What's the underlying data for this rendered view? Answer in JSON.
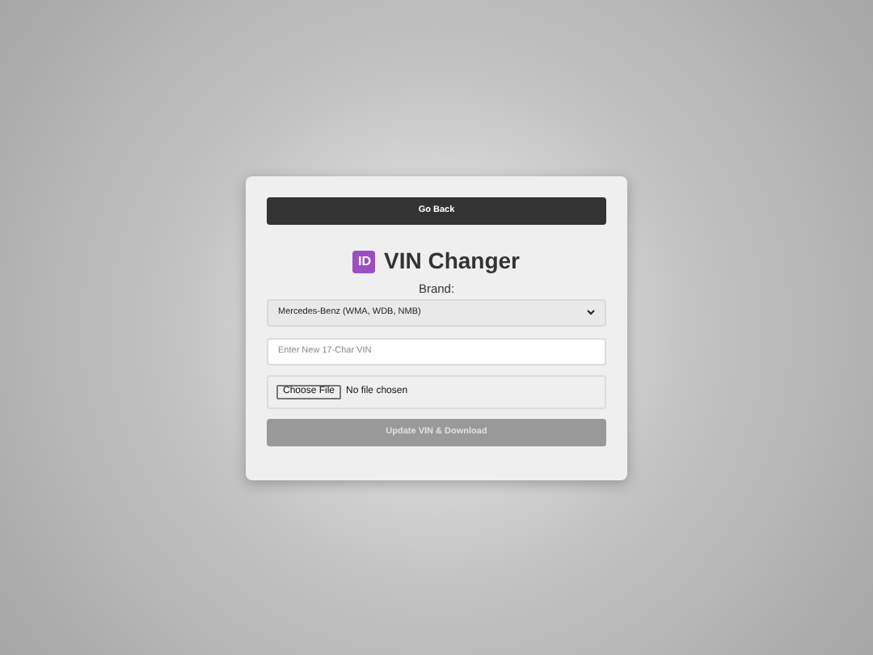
{
  "back_button": "Go Back",
  "title": {
    "badge": "ID",
    "text": "VIN Changer"
  },
  "brand": {
    "label": "Brand:",
    "value": "Mercedes-Benz (WMA, WDB, NMB)"
  },
  "vin_field": {
    "placeholder": "Enter New 17-Char VIN"
  },
  "file_picker": {
    "button": "Choose File",
    "status": "No file chosen"
  },
  "submit_button": {
    "label": "Update VIN & Download",
    "disabled": true
  }
}
